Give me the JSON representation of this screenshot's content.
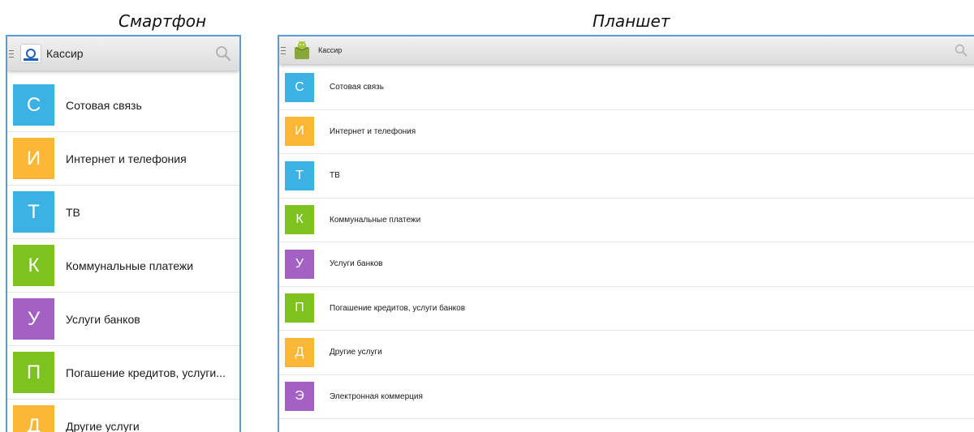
{
  "captions": {
    "phone": "Смартфон",
    "tablet": "Планшет"
  },
  "phone": {
    "app_title": "Кассир",
    "icons": {
      "menu": "menu-icon",
      "app": "kassir-logo-icon",
      "search": "search-icon"
    },
    "items": [
      {
        "letter": "С",
        "label": "Сотовая связь",
        "color": "#3cb2e4"
      },
      {
        "letter": "И",
        "label": "Интернет и телефония",
        "color": "#fbb735"
      },
      {
        "letter": "Т",
        "label": "ТВ",
        "color": "#3cb2e4"
      },
      {
        "letter": "К",
        "label": "Коммунальные платежи",
        "color": "#7dc21e"
      },
      {
        "letter": "У",
        "label": "Услуги банков",
        "color": "#a461c4"
      },
      {
        "letter": "П",
        "label": "Погашение кредитов, услуги...",
        "color": "#7dc21e"
      },
      {
        "letter": "Д",
        "label": "Другие услуги",
        "color": "#fbb735"
      }
    ]
  },
  "tablet": {
    "app_title": "Кассир",
    "icons": {
      "menu": "menu-icon",
      "app": "android-box-icon",
      "search": "search-icon"
    },
    "items": [
      {
        "letter": "С",
        "label": "Сотовая связь",
        "color": "#3cb2e4"
      },
      {
        "letter": "И",
        "label": "Интернет и телефония",
        "color": "#fbb735"
      },
      {
        "letter": "Т",
        "label": "ТВ",
        "color": "#3cb2e4"
      },
      {
        "letter": "К",
        "label": "Коммунальные платежи",
        "color": "#7dc21e"
      },
      {
        "letter": "У",
        "label": "Услуги банков",
        "color": "#a461c4"
      },
      {
        "letter": "П",
        "label": "Погашение кредитов, услуги банков",
        "color": "#7dc21e"
      },
      {
        "letter": "Д",
        "label": "Другие услуги",
        "color": "#fbb735"
      },
      {
        "letter": "Э",
        "label": "Электронная коммерция",
        "color": "#a461c4"
      }
    ]
  },
  "colors": {
    "device_border": "#5b9bd5",
    "actionbar": "#e4e4e4",
    "divider": "#e6e6e6"
  }
}
